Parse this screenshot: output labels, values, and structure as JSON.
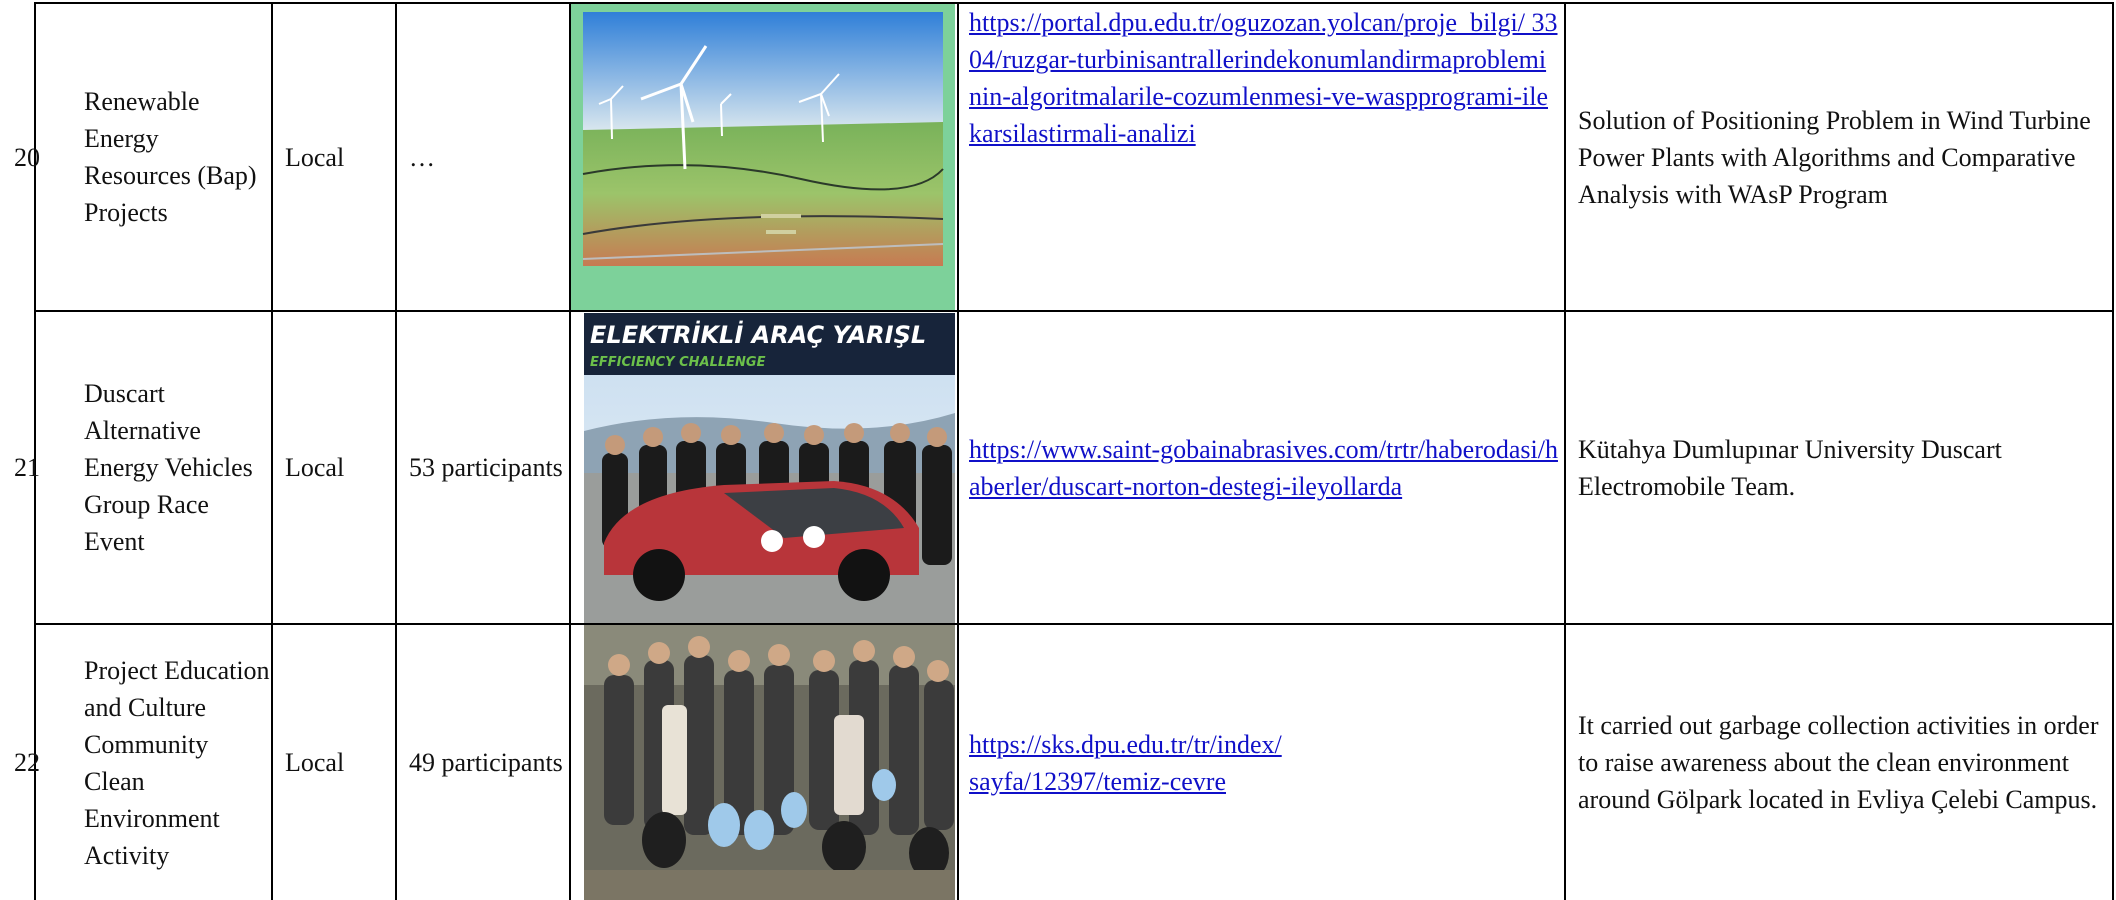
{
  "rows": [
    {
      "num": "20",
      "activity": "Renewable Energy Resources (Bap) Projects",
      "scope": "Local",
      "participants": "…",
      "link": "https://portal.dpu.edu.tr/oguzozan.yolcan/proje_bilgi/ 3304/ruzgar-turbinisantrallerindekonumlandirmaprobleminin-algoritmalarile-cozumlenmesi-ve-waspprogrami-ilekarsilastirmali-analizi",
      "description": "Solution of Positioning Problem in Wind Turbine Power Plants with Algorithms and Comparative Analysis with WAsP Program"
    },
    {
      "num": "21",
      "activity": "Duscart Alternative Energy Vehicles Group Race Event",
      "scope": "Local",
      "participants": "53 participants",
      "photo_banner": "ELEKTRİKLİ ARAÇ YARIŞL",
      "photo_banner_sub": "EFFICIENCY CHALLENGE",
      "link": "https://www.saint-gobainabrasives.com/trtr/haberodasi/haberler/duscart-norton-destegi-ileyollarda",
      "description": "Kütahya Dumlupınar University Duscart Electromobile Team."
    },
    {
      "num": "22",
      "activity": "Project Education and Culture Community Clean Environment Activity",
      "scope": "Local",
      "participants": "49 participants",
      "link": "https://sks.dpu.edu.tr/tr/index/sayfa/12397/temiz-cevre",
      "description": "It carried out garbage collection activities in order to raise awareness about the clean environment around Gölpark located in Evliya Çelebi Campus."
    }
  ],
  "colors": {
    "link": "#1010c8",
    "border": "#000000"
  }
}
